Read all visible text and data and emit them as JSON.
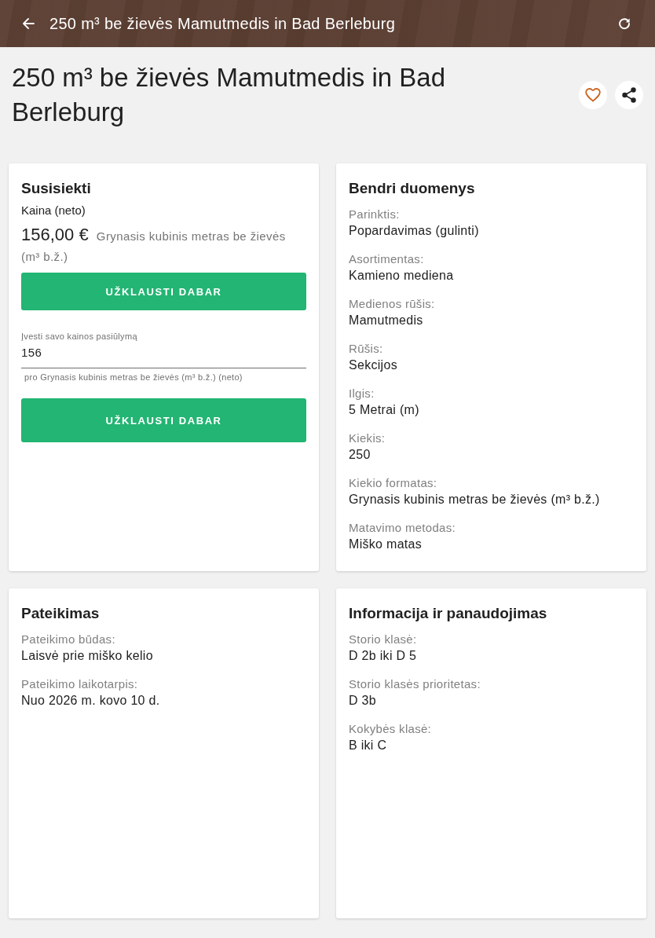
{
  "app_bar": {
    "title": "250 m³ be žievės Mamutmedis in Bad Berleburg"
  },
  "header": {
    "title": "250 m³ be žievės Mamutmedis in Bad Berleburg",
    "favorited": false
  },
  "cards": [
    {
      "kind": "contact",
      "title": "Susisiekti",
      "price_label": "Kaina (neto)",
      "price": "156,00 €",
      "price_unit": "Grynasis kubinis metras be žievės (m³ b.ž.)",
      "inquire_button": "UŽKLAUSTI DABAR",
      "offer_field": {
        "label": "Įvesti savo kainos pasiūlymą",
        "value": "156",
        "helper": "pro Grynasis kubinis metras be žievės (m³ b.ž.) (neto)"
      },
      "offer_button": "UŽKLAUSTI DABAR"
    },
    {
      "kind": "details",
      "title": "Bendri duomenys",
      "fields": [
        {
          "label": "Parinktis:",
          "value": "Popardavimas (gulinti)"
        },
        {
          "label": "Asortimentas:",
          "value": "Kamieno mediena"
        },
        {
          "label": "Medienos rūšis:",
          "value": "Mamutmedis"
        },
        {
          "label": "Rūšis:",
          "value": "Sekcijos"
        },
        {
          "label": "Ilgis:",
          "value": "5 Metrai (m)"
        },
        {
          "label": "Kiekis:",
          "value": "250"
        },
        {
          "label": "Kiekio formatas:",
          "value": "Grynasis kubinis metras be žievės (m³ b.ž.)"
        },
        {
          "label": "Matavimo metodas:",
          "value": "Miško matas"
        }
      ]
    },
    {
      "kind": "details",
      "title": "Pateikimas",
      "fields": [
        {
          "label": "Pateikimo būdas:",
          "value": "Laisvė prie miško kelio"
        },
        {
          "label": "Pateikimo laikotarpis:",
          "value": "Nuo 2026 m. kovo 10 d."
        }
      ]
    },
    {
      "kind": "details",
      "title": "Informacija ir panaudojimas",
      "fields": [
        {
          "label": "Storio klasė:",
          "value": "D 2b iki D 5"
        },
        {
          "label": "Storio klasės prioritetas:",
          "value": "D 3b"
        },
        {
          "label": "Kokybės klasė:",
          "value": "B iki C"
        }
      ]
    }
  ]
}
